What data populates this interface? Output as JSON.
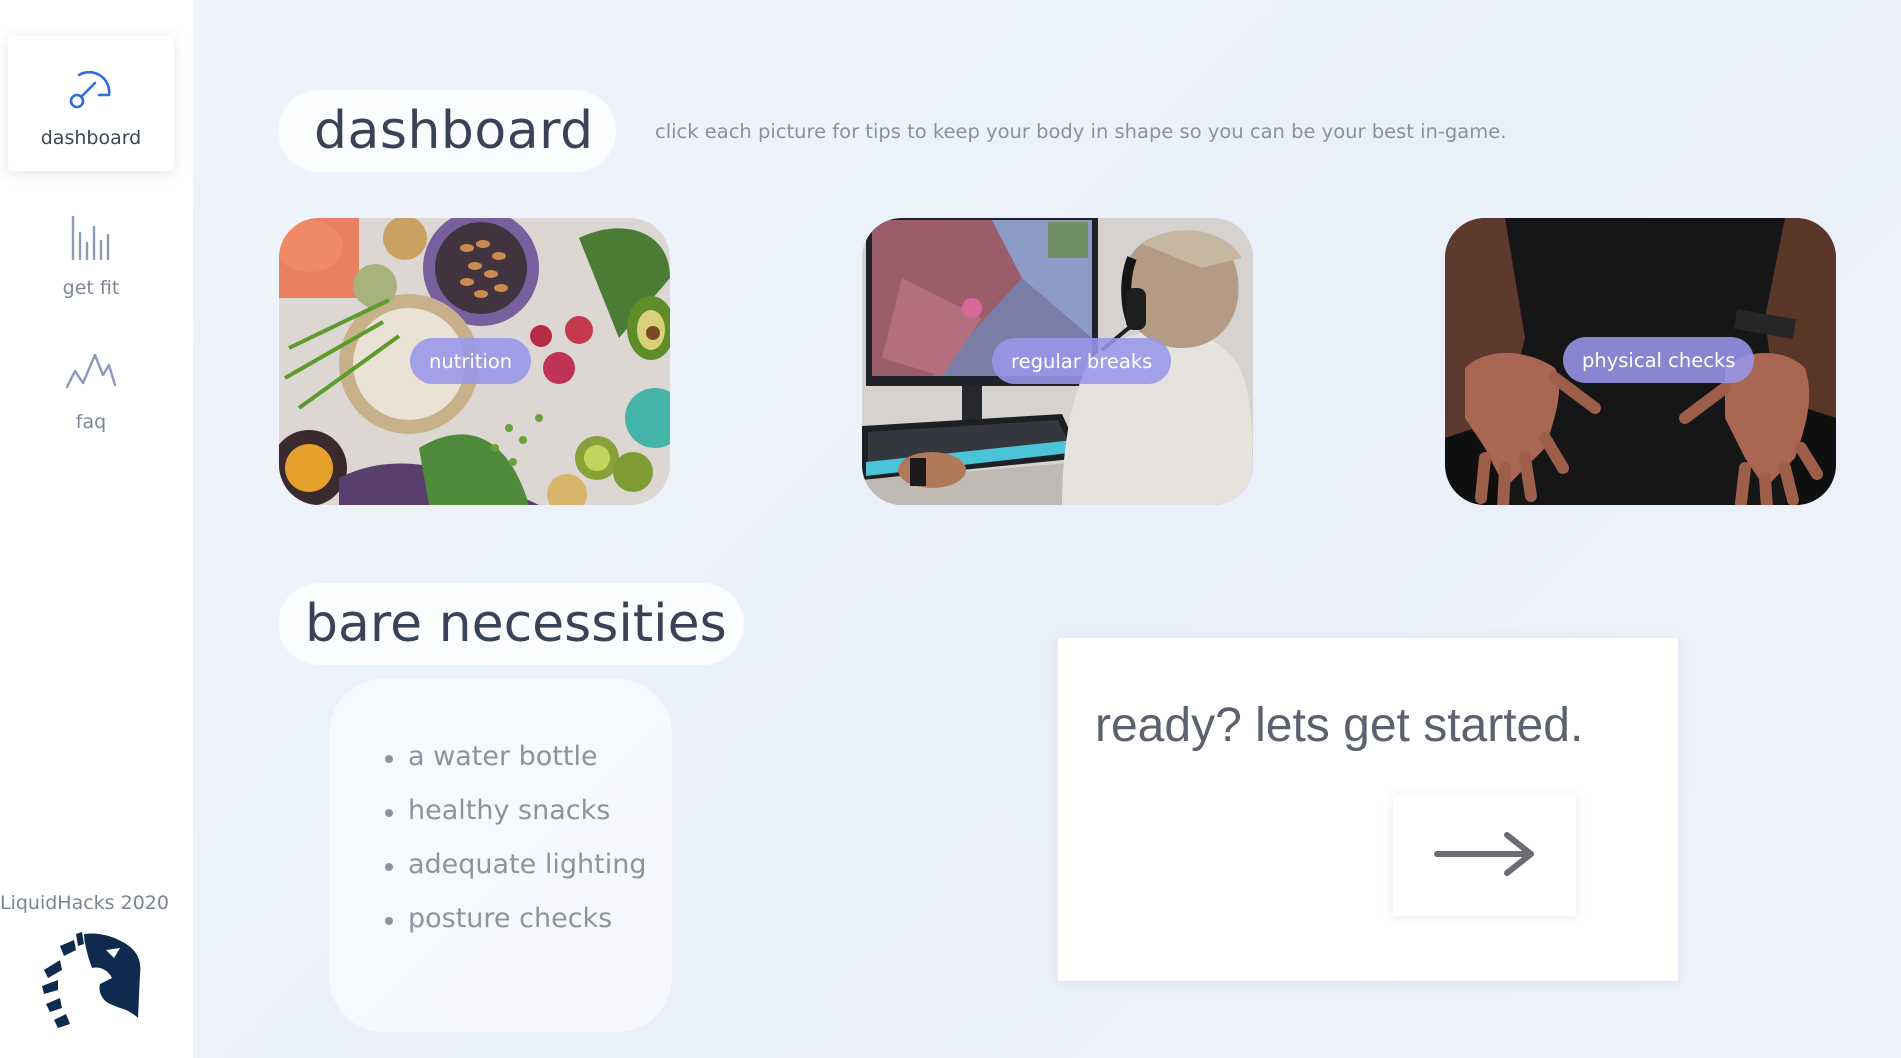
{
  "sidebar": {
    "items": [
      {
        "label": "dashboard",
        "icon": "speedometer-icon",
        "active": true
      },
      {
        "label": "get fit",
        "icon": "bar-chart-icon",
        "active": false
      },
      {
        "label": "faq",
        "icon": "pulse-line-icon",
        "active": false
      }
    ],
    "brand": "LiquidHacks 2020",
    "logo": "liquid-horse-logo"
  },
  "header": {
    "title": "dashboard",
    "subtitle": "click each picture for tips to keep your body in shape so you can be your best in-game."
  },
  "cards": [
    {
      "label": "nutrition",
      "image": "food-bowls-photo"
    },
    {
      "label": "regular breaks",
      "image": "gamer-at-pc-photo"
    },
    {
      "label": "physical checks",
      "image": "hands-stretch-photo"
    }
  ],
  "necessities": {
    "title": "bare necessities",
    "items": [
      "a water bottle",
      "healthy snacks",
      "adequate lighting",
      "posture checks"
    ]
  },
  "cta": {
    "text": "ready? lets get started.",
    "button_icon": "arrow-right-icon"
  },
  "colors": {
    "accent": "#2f6de0",
    "label_bg": "#9896eb",
    "title_text": "#3b4258"
  }
}
